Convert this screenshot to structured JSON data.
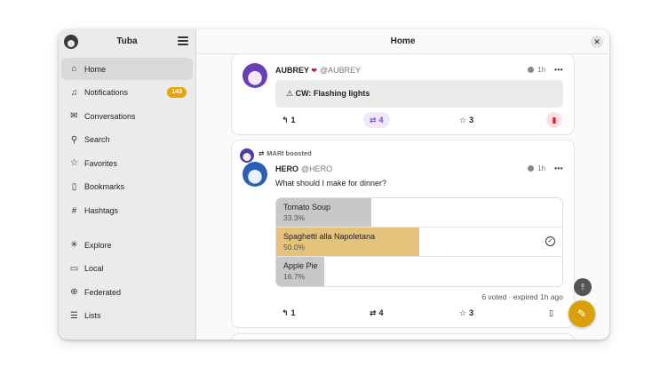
{
  "sidebar": {
    "title": "Tuba",
    "items": [
      {
        "label": "Home",
        "icon": "home-icon"
      },
      {
        "label": "Notifications",
        "icon": "bell-icon",
        "badge": "143"
      },
      {
        "label": "Conversations",
        "icon": "mail-icon"
      },
      {
        "label": "Search",
        "icon": "search-icon"
      },
      {
        "label": "Favorites",
        "icon": "star-icon"
      },
      {
        "label": "Bookmarks",
        "icon": "bookmark-icon"
      },
      {
        "label": "Hashtags",
        "icon": "hash-icon"
      },
      {
        "label": "Explore",
        "icon": "explore-icon"
      },
      {
        "label": "Local",
        "icon": "monitor-icon"
      },
      {
        "label": "Federated",
        "icon": "globe-icon"
      },
      {
        "label": "Lists",
        "icon": "list-icon"
      }
    ]
  },
  "header": {
    "title": "Home"
  },
  "posts": [
    {
      "author": "AUBREY",
      "handle": "@AUBREY",
      "time": "1h",
      "cw": "CW: Flashing lights",
      "replies": "1",
      "boosts": "4",
      "favorites": "3"
    },
    {
      "boosted_by": "MARI boosted",
      "author": "HERO",
      "handle": "@HERO",
      "time": "1h",
      "text": "What should I make for dinner?",
      "poll": {
        "options": [
          {
            "label": "Tomato Soup",
            "percent": "33.3%",
            "fraction": 0.333
          },
          {
            "label": "Spaghetti alla Napoletana",
            "percent": "50.0%",
            "fraction": 0.5,
            "voted": true
          },
          {
            "label": "Apple Pie",
            "percent": "16.7%",
            "fraction": 0.167
          }
        ],
        "footer": "6 voted · expired 1h ago"
      },
      "replies": "1",
      "boosts": "4",
      "favorites": "3"
    }
  ],
  "colors": {
    "accent": "#e5a50a",
    "boost": "#7a49d6",
    "bookmark": "#e01b24",
    "poll_fill": "#c8c8c8",
    "poll_voted": "#e5c27a"
  }
}
